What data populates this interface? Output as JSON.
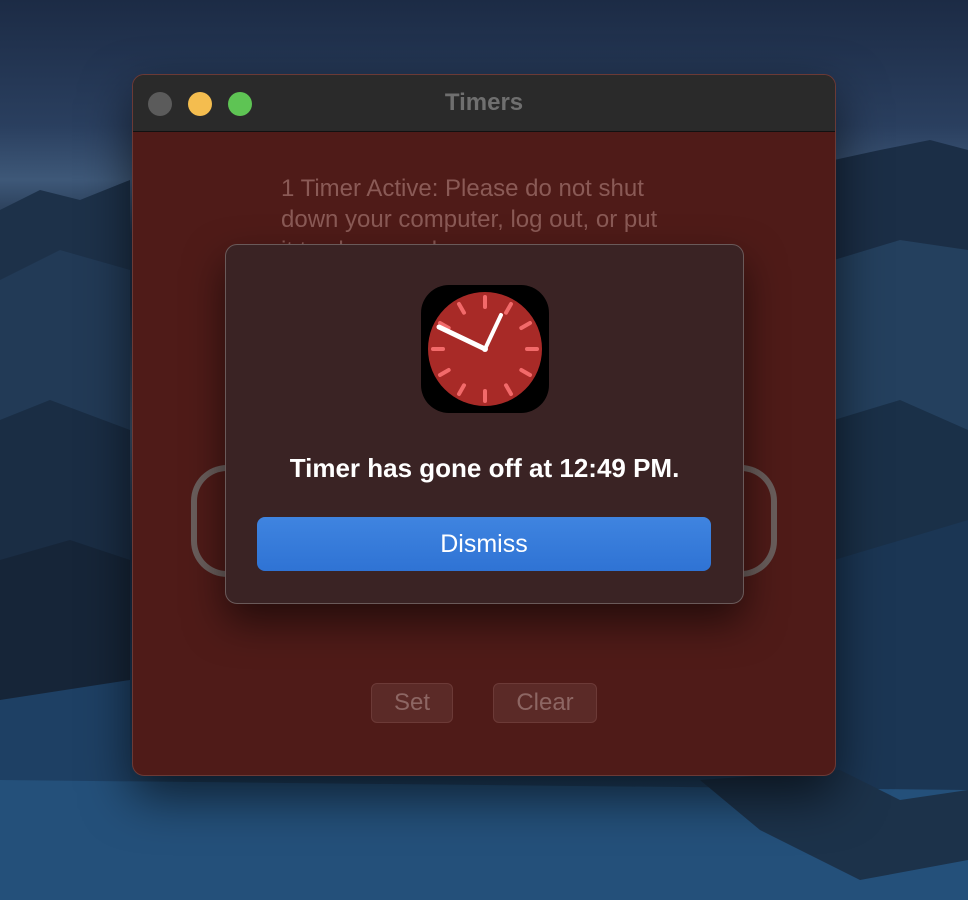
{
  "window": {
    "title": "Timers",
    "status_text": "1 Timer Active: Please do not shut down your computer, log out, or put it to sleep or else",
    "set_label": "Set",
    "clear_label": "Clear",
    "colors": {
      "background": "#4f1b18",
      "titlebar": "#2a2a2a"
    }
  },
  "alert": {
    "icon": "clock-icon",
    "message": "Timer has gone off at 12:49 PM.",
    "dismiss_label": "Dismiss",
    "colors": {
      "dismiss_button": "#2f73d4",
      "clock_face": "#a82a27"
    }
  }
}
